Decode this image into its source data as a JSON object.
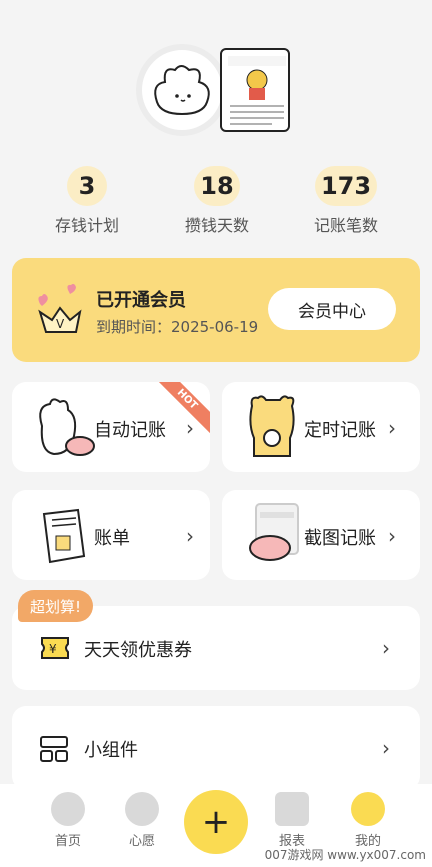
{
  "stats": [
    {
      "value": "3",
      "label": "存钱计划"
    },
    {
      "value": "18",
      "label": "攒钱天数"
    },
    {
      "value": "173",
      "label": "记账笔数"
    }
  ],
  "vip": {
    "title": "已开通会员",
    "expire": "到期时间：2025-06-19",
    "center_button": "会员中心"
  },
  "features": {
    "auto": {
      "label": "自动记账",
      "badge": "HOT"
    },
    "timed": {
      "label": "定时记账"
    },
    "bill": {
      "label": "账单"
    },
    "screenshot": {
      "label": "截图记账"
    }
  },
  "promo_tag": "超划算!",
  "rows": {
    "coupon": "天天领优惠券",
    "widget": "小组件"
  },
  "nav": {
    "home": "首页",
    "wish": "心愿",
    "add": "+",
    "report": "报表",
    "mine": "我的"
  },
  "watermark": "007游戏网 www.yx007.com",
  "colors": {
    "accent": "#fadb7d",
    "fab": "#fadb52",
    "hot": "#ef7f61",
    "promo": "#f2a867"
  }
}
